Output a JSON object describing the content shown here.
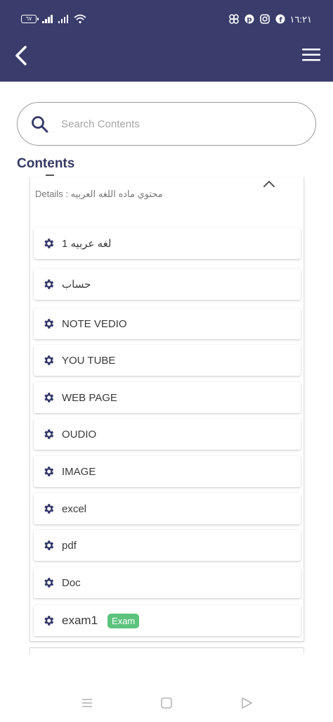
{
  "status_bar": {
    "battery": "٦٧",
    "time": "١٦:٢١"
  },
  "search": {
    "placeholder": "Search Contents"
  },
  "section": {
    "title": "Contents"
  },
  "panel": {
    "details": "Details : محتوي ماده اللغه العربيه"
  },
  "items": [
    {
      "label": "لغه عربيه 1"
    },
    {
      "label": "حساب"
    },
    {
      "label": "NOTE VEDIO"
    },
    {
      "label": "YOU  TUBE"
    },
    {
      "label": "WEB PAGE"
    },
    {
      "label": "OUDIO"
    },
    {
      "label": "IMAGE"
    },
    {
      "label": "excel"
    },
    {
      "label": "pdf"
    },
    {
      "label": "Doc"
    },
    {
      "label": "exam1",
      "badge": "Exam"
    }
  ],
  "colors": {
    "primary": "#3a3d6b",
    "badge": "#5cc37d"
  }
}
